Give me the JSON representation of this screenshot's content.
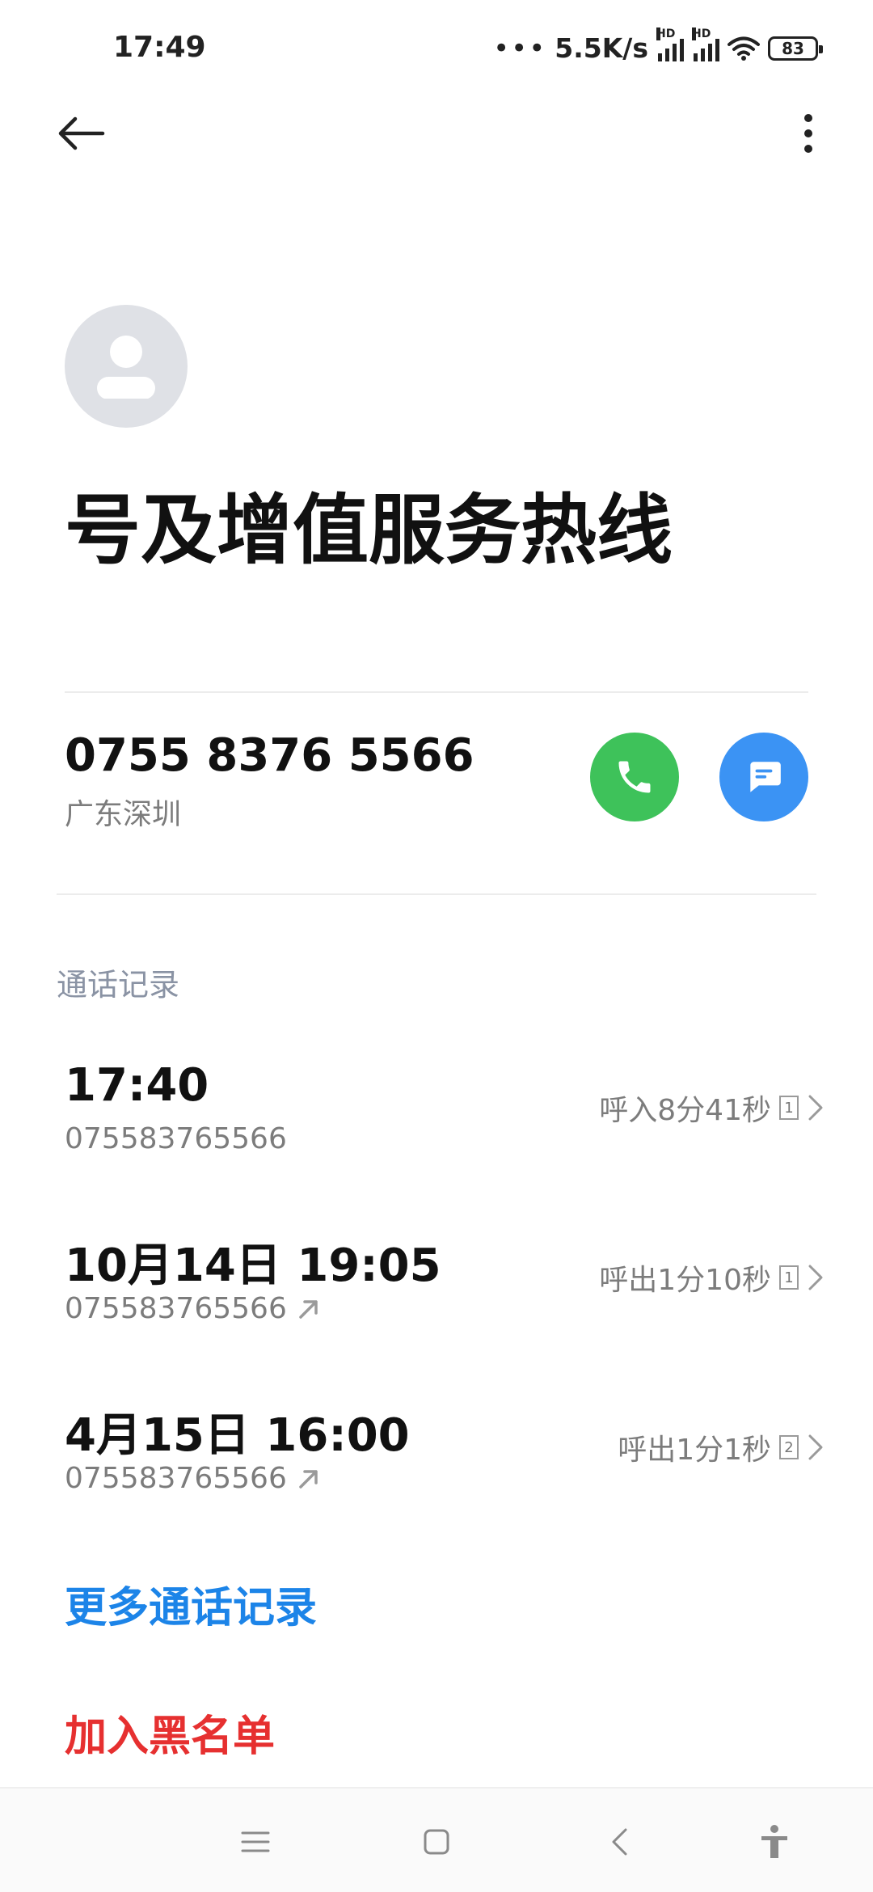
{
  "status_bar": {
    "time": "17:49",
    "dots": "•••",
    "network_speed": "5.5K/s",
    "signal_badge": "HD",
    "battery": "83"
  },
  "contact": {
    "name": "号及增值服务热线"
  },
  "phone": {
    "number": "0755 8376 5566",
    "location": "广东深圳"
  },
  "call_log": {
    "title": "通话记录",
    "records": [
      {
        "time": "17:40",
        "number": "075583765566",
        "outgoing": false,
        "detail": "呼入8分41秒",
        "sim": "1"
      },
      {
        "time": "10月14日 19:05",
        "number": "075583765566",
        "outgoing": true,
        "detail": "呼出1分10秒",
        "sim": "1"
      },
      {
        "time": "4月15日 16:00",
        "number": "075583765566",
        "outgoing": true,
        "detail": "呼出1分1秒",
        "sim": "2"
      }
    ]
  },
  "actions": {
    "more_records": "更多通话记录",
    "blacklist": "加入黑名单"
  },
  "colors": {
    "call_green": "#3ec25a",
    "message_blue": "#3b93f4",
    "link_blue": "#1c84e8",
    "danger_red": "#e63030",
    "section_gray": "#8a93a4"
  },
  "icons": [
    "back-arrow-icon",
    "more-vertical-icon",
    "person-icon",
    "phone-icon",
    "message-icon",
    "outgoing-arrow-icon",
    "chevron-right-icon",
    "menu-icon",
    "home-icon",
    "back-icon",
    "accessibility-icon"
  ]
}
